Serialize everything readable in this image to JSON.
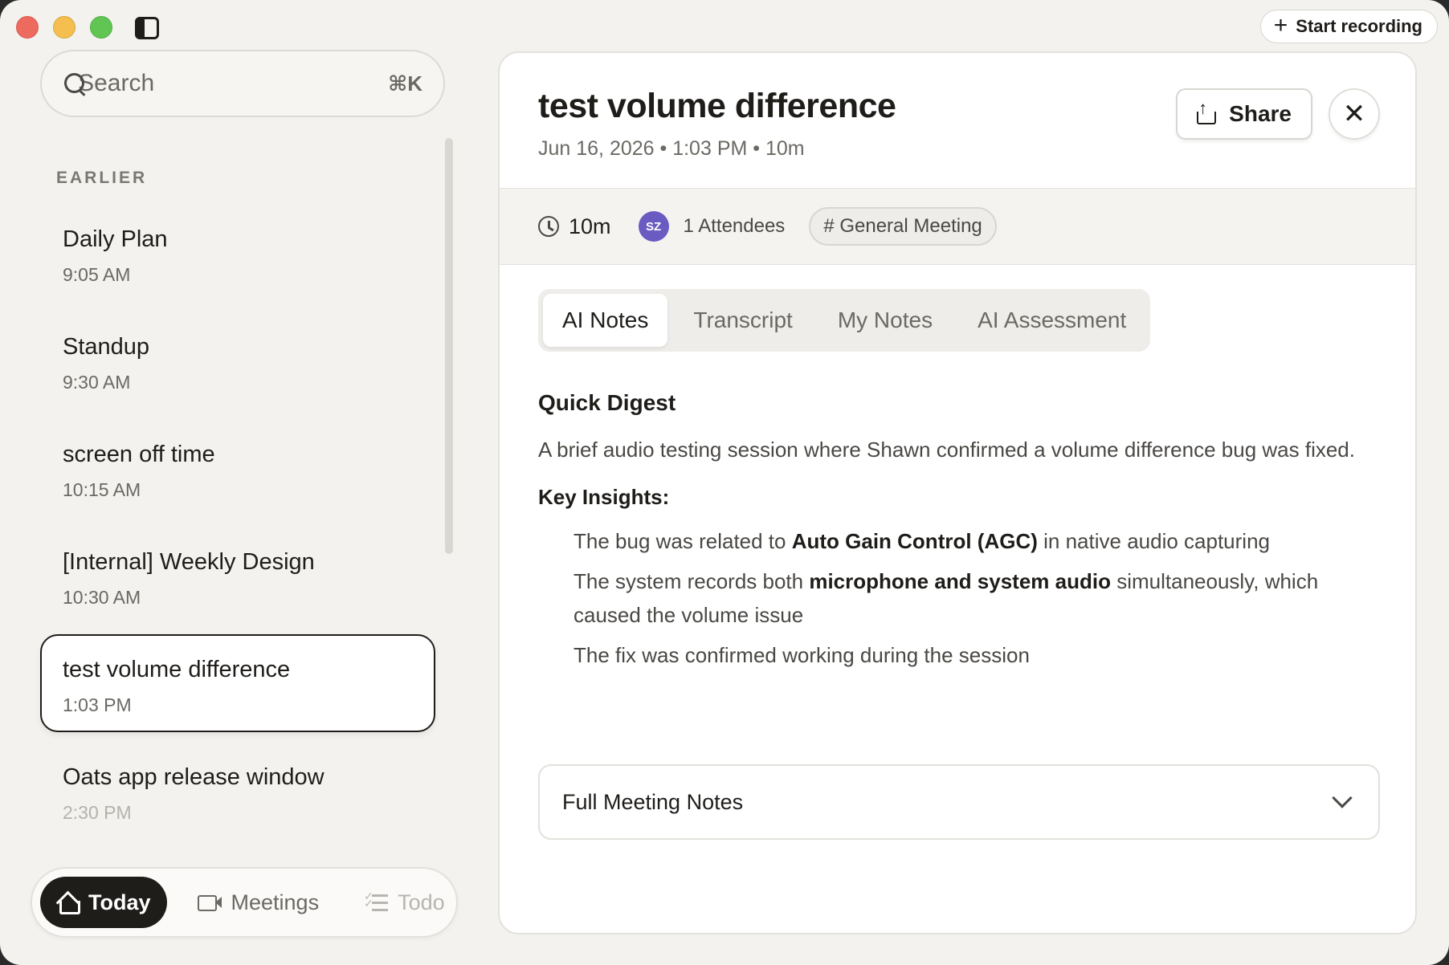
{
  "titlebar": {
    "start_recording_label": "Start recording"
  },
  "search": {
    "placeholder": "Search",
    "shortcut": "⌘K"
  },
  "sidebar": {
    "section_label": "EARLIER",
    "meetings": [
      {
        "title": "Daily Plan",
        "time": "9:05 AM"
      },
      {
        "title": "Standup",
        "time": "9:30 AM"
      },
      {
        "title": "screen off time",
        "time": "10:15 AM"
      },
      {
        "title": "[Internal] Weekly Design",
        "time": "10:30 AM"
      },
      {
        "title": "test volume difference",
        "time": "1:03 PM"
      },
      {
        "title": "Oats app release window",
        "time": "2:30 PM"
      }
    ],
    "selected_index": 4
  },
  "bottom_nav": {
    "today": "Today",
    "meetings": "Meetings",
    "todo": "Todo"
  },
  "meeting": {
    "title": "test volume difference",
    "subtitle": "Jun 16, 2026 • 1:03 PM • 10m",
    "share_label": "Share",
    "duration": "10m",
    "avatar_initials": "SZ",
    "attendees": "1 Attendees",
    "tag": "# General Meeting"
  },
  "tabs": [
    "AI Notes",
    "Transcript",
    "My Notes",
    "AI Assessment"
  ],
  "active_tab": "AI Notes",
  "notes": {
    "digest_heading": "Quick Digest",
    "digest": "A brief audio testing session where Shawn confirmed a volume difference bug was fixed.",
    "insights_heading": "Key Insights:",
    "insights": [
      {
        "pre": "The bug was related to ",
        "bold": "Auto Gain Control (AGC)",
        "post": " in native audio capturing"
      },
      {
        "pre": "The system records both ",
        "bold": "microphone and system audio",
        "post": " simultaneously, which caused the volume issue"
      },
      {
        "pre": "The fix was confirmed working during the session",
        "bold": "",
        "post": ""
      }
    ],
    "full_notes_label": "Full Meeting Notes"
  },
  "colors": {
    "accent_dark": "#1f1d1a",
    "avatar": "#6a5bc2",
    "background": "#f3f2ef"
  }
}
